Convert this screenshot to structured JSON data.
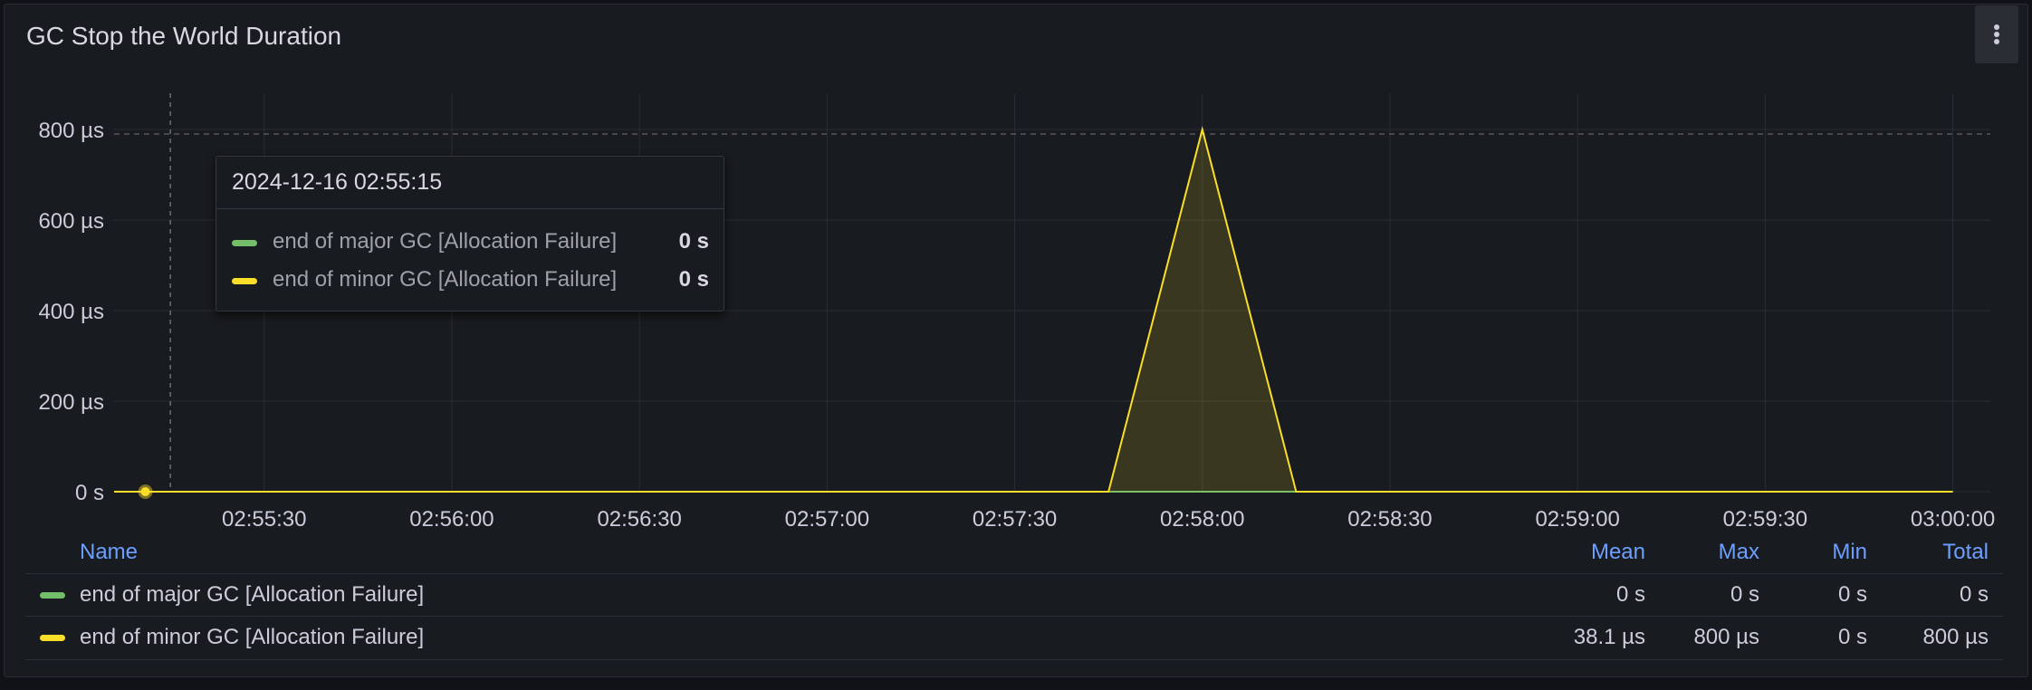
{
  "panel": {
    "title": "GC Stop the World Duration",
    "menu_icon": "vertical-ellipsis-icon"
  },
  "chart_data": {
    "type": "line",
    "yunit": "µs",
    "ylim": [
      0,
      800
    ],
    "y_ticks": [
      "0 s",
      "200 µs",
      "400 µs",
      "600 µs",
      "800 µs"
    ],
    "y_tick_values": [
      0,
      200,
      400,
      600,
      800
    ],
    "x_ticks": [
      "02:55:30",
      "02:56:00",
      "02:56:30",
      "02:57:00",
      "02:57:30",
      "02:58:00",
      "02:58:30",
      "02:59:00",
      "02:59:30",
      "03:00:00"
    ],
    "x_tick_values": [
      "2024-12-16 02:55:30",
      "2024-12-16 02:56:00",
      "2024-12-16 02:56:30",
      "2024-12-16 02:57:00",
      "2024-12-16 02:57:30",
      "2024-12-16 02:58:00",
      "2024-12-16 02:58:30",
      "2024-12-16 02:59:00",
      "2024-12-16 02:59:30",
      "2024-12-16 03:00:00"
    ],
    "xlim": [
      "2024-12-16 02:55:06",
      "2024-12-16 03:00:06"
    ],
    "threshold": 790,
    "cursor_time": "2024-12-16 02:55:15",
    "grid": true,
    "series": [
      {
        "name": "end of major GC [Allocation Failure]",
        "color": "#73bf69",
        "x": [
          "2024-12-16 02:55:06",
          "2024-12-16 03:00:00"
        ],
        "y": [
          0,
          0
        ]
      },
      {
        "name": "end of minor GC [Allocation Failure]",
        "color": "#fade2a",
        "fill": true,
        "x": [
          "2024-12-16 02:55:06",
          "2024-12-16 02:57:45",
          "2024-12-16 02:58:00",
          "2024-12-16 02:58:15",
          "2024-12-16 03:00:00"
        ],
        "y": [
          0,
          0,
          800,
          0,
          0
        ]
      }
    ]
  },
  "tooltip": {
    "time": "2024-12-16 02:55:15",
    "rows": [
      {
        "name": "end of major GC [Allocation Failure]",
        "value": "0 s",
        "color": "#73bf69"
      },
      {
        "name": "end of minor GC [Allocation Failure]",
        "value": "0 s",
        "color": "#fade2a"
      }
    ]
  },
  "legend": {
    "headers": {
      "name": "Name",
      "mean": "Mean",
      "max": "Max",
      "min": "Min",
      "total": "Total"
    },
    "rows": [
      {
        "name": "end of major GC [Allocation Failure]",
        "color": "#73bf69",
        "mean": "0 s",
        "max": "0 s",
        "min": "0 s",
        "total": "0 s"
      },
      {
        "name": "end of minor GC [Allocation Failure]",
        "color": "#fade2a",
        "mean": "38.1 µs",
        "max": "800 µs",
        "min": "0 s",
        "total": "800 µs"
      }
    ]
  }
}
